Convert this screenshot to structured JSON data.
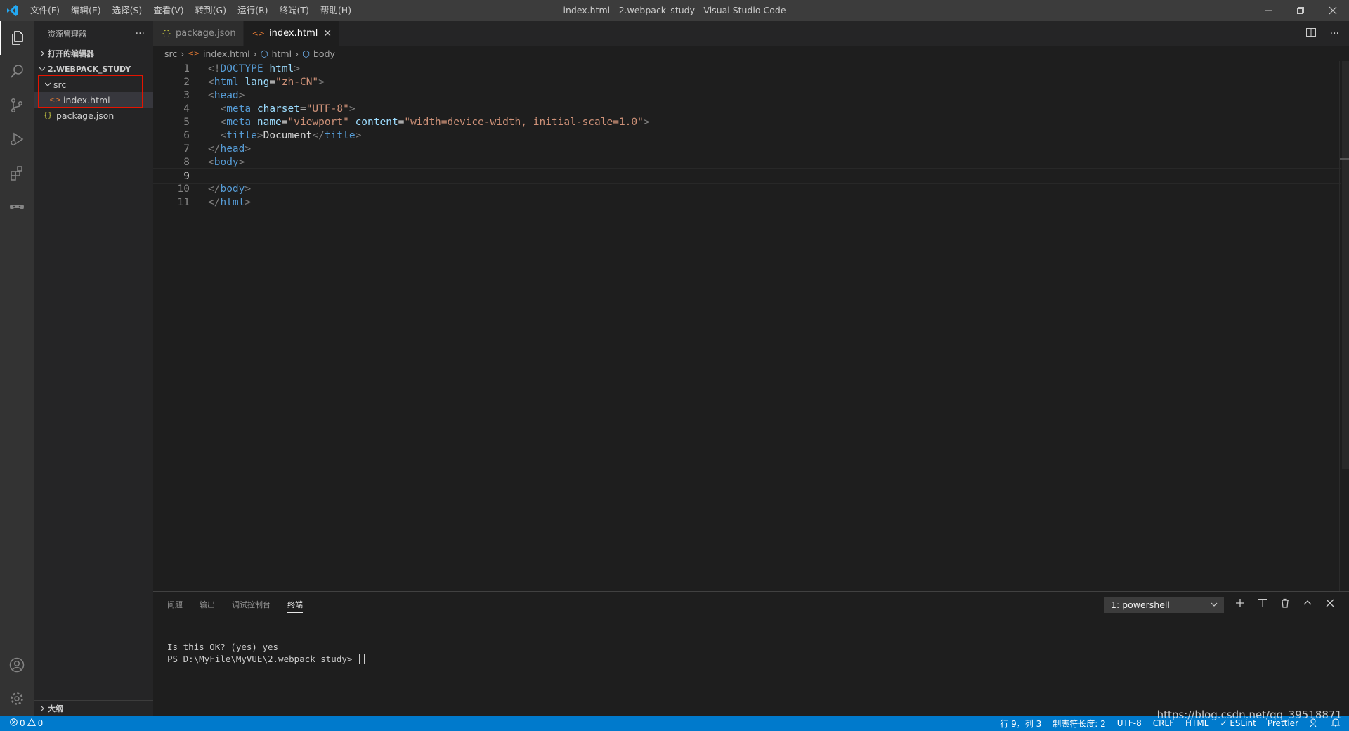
{
  "window": {
    "title": "index.html - 2.webpack_study - Visual Studio Code",
    "menu": [
      "文件(F)",
      "编辑(E)",
      "选择(S)",
      "查看(V)",
      "转到(G)",
      "运行(R)",
      "终端(T)",
      "帮助(H)"
    ]
  },
  "sidebar": {
    "title": "资源管理器",
    "more": "···",
    "open_editors": "打开的编辑器",
    "project": "2.WEBPACK_STUDY",
    "tree": {
      "folder": "src",
      "file_in_folder": "index.html",
      "root_file": "package.json"
    },
    "outline": "大纲"
  },
  "tabs": [
    {
      "label": "package.json",
      "icon": "{}"
    },
    {
      "label": "index.html",
      "icon": "<>",
      "close": "✕"
    }
  ],
  "breadcrumb": [
    "src",
    "index.html",
    "html",
    "body"
  ],
  "editor": {
    "line_numbers": [
      "1",
      "2",
      "3",
      "4",
      "5",
      "6",
      "7",
      "8",
      "9",
      "10",
      "11"
    ],
    "current_line": 9
  },
  "panel": {
    "tabs": [
      "问题",
      "输出",
      "调试控制台",
      "终端"
    ],
    "terminal_select": "1: powershell",
    "terminal_lines": [
      "Is this OK? (yes) yes",
      "PS D:\\MyFile\\MyVUE\\2.webpack_study> "
    ]
  },
  "status": {
    "errors": "0",
    "warnings": "0",
    "position": "行 9，列 3",
    "tab_size": "制表符长度: 2",
    "encoding": "UTF-8",
    "eol": "CRLF",
    "language": "HTML",
    "eslint": "ESLint",
    "prettier": "Prettier"
  },
  "watermark": "https://blog.csdn.net/qq_39518871",
  "colors": {
    "accent": "#007acc",
    "highlight_box": "#e51400",
    "tag": "#569cd6",
    "attribute": "#9cdcfe",
    "string": "#ce9178"
  }
}
